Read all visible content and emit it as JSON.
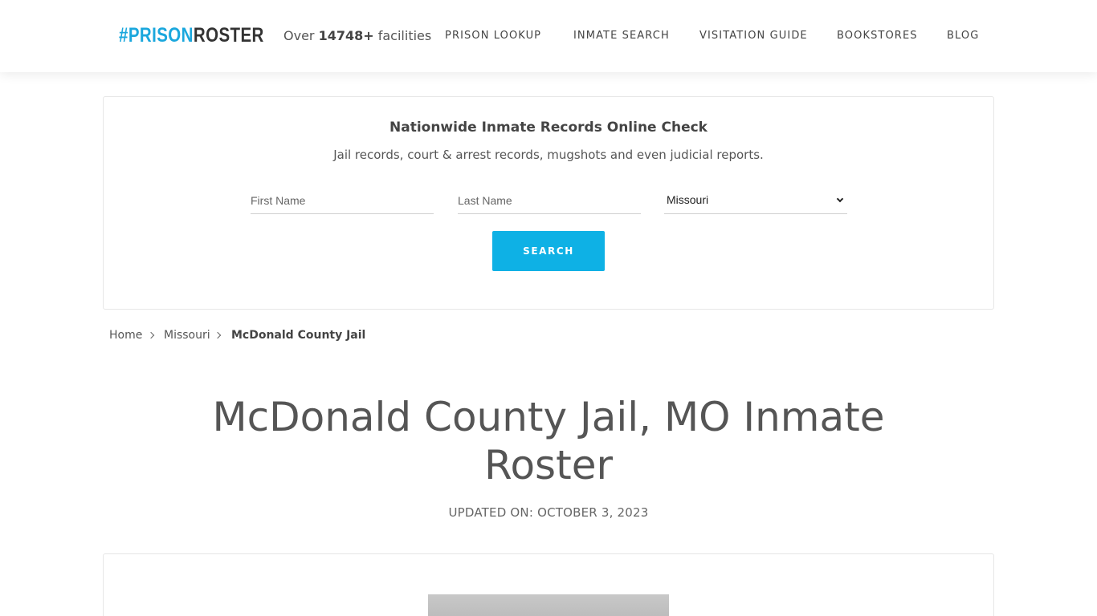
{
  "header": {
    "logo": {
      "hash": "#",
      "prison": "PRISON",
      "roster": "ROSTER"
    },
    "facilities": {
      "prefix": "Over ",
      "count": "14748+",
      "suffix": " facilities"
    },
    "nav": [
      {
        "label": "PRISON LOOKUP"
      },
      {
        "label": "INMATE SEARCH"
      },
      {
        "label": "VISITATION GUIDE"
      },
      {
        "label": "BOOKSTORES"
      },
      {
        "label": "BLOG"
      }
    ]
  },
  "search_card": {
    "title": "Nationwide Inmate Records Online Check",
    "subtitle": "Jail records, court & arrest records, mugshots and even judicial reports.",
    "first_name_placeholder": "First Name",
    "last_name_placeholder": "Last Name",
    "state_selected": "Missouri",
    "button_label": "SEARCH"
  },
  "breadcrumb": [
    {
      "label": "Home"
    },
    {
      "label": "Missouri"
    },
    {
      "label": "McDonald County Jail"
    }
  ],
  "page": {
    "title": "McDonald County Jail, MO Inmate Roster",
    "updated": "UPDATED ON: OCTOBER 3, 2023"
  },
  "colors": {
    "accent": "#0eb1e5",
    "logo_blue": "#1aa7dd",
    "text": "#555555"
  }
}
